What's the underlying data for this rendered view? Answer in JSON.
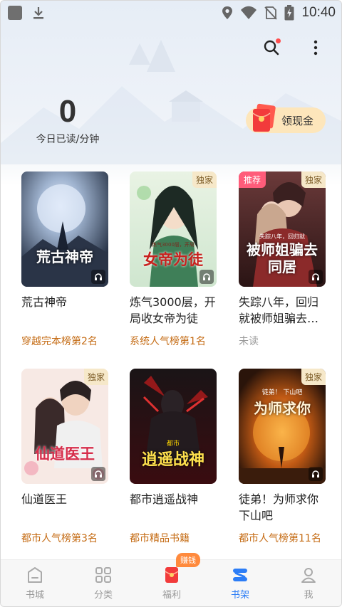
{
  "status_bar": {
    "time": "10:40",
    "icons": [
      "app-square-icon",
      "download-icon",
      "location-icon",
      "wifi-icon",
      "no-sim-icon",
      "battery-charging-icon"
    ]
  },
  "header": {
    "search_icon": "search-icon",
    "more_icon": "more-vertical-icon"
  },
  "reading": {
    "value": "0",
    "label": "今日已读/分钟"
  },
  "withdraw": {
    "label": "领现金"
  },
  "books": [
    {
      "title": "荒古神帝",
      "tag": "穿越完本榜第2名",
      "exclusive": "",
      "recommend": "",
      "cover_title": "荒古神帝",
      "cover_sub": ""
    },
    {
      "title": "炼气3000层，开局收女帝为徒",
      "tag": "系统人气榜第1名",
      "exclusive": "独家",
      "recommend": "",
      "cover_title": "女帝为徒",
      "cover_sub": "炼气3000层，开局"
    },
    {
      "title": "失踪八年，回归就被师姐骗去…",
      "tag": "未读",
      "exclusive": "独家",
      "recommend": "推荐",
      "cover_title": "被师姐骗去同居",
      "cover_sub": "失踪八年，回归就"
    },
    {
      "title": "仙道医王",
      "tag": "都市人气榜第3名",
      "exclusive": "独家",
      "recommend": "",
      "cover_title": "仙道医王",
      "cover_sub": ""
    },
    {
      "title": "都市逍遥战神",
      "tag": "都市精品书籍",
      "exclusive": "",
      "recommend": "",
      "cover_title": "逍遥战神",
      "cover_sub": "都市"
    },
    {
      "title": "徒弟！为师求你下山吧",
      "tag": "都市人气榜第11名",
      "exclusive": "独家",
      "recommend": "",
      "cover_title": "为师求你",
      "cover_sub": "徒弟！ 下山吧"
    }
  ],
  "bottom_nav": [
    {
      "label": "书城",
      "icon": "store-icon",
      "active": false
    },
    {
      "label": "分类",
      "icon": "category-grid-icon",
      "active": false
    },
    {
      "label": "福利",
      "icon": "red-envelope-icon",
      "active": false,
      "badge": "赚钱"
    },
    {
      "label": "书架",
      "icon": "bookshelf-icon",
      "active": true
    },
    {
      "label": "我",
      "icon": "profile-icon",
      "active": false
    }
  ],
  "colors": {
    "accent_blue": "#2c7df6",
    "tag_orange": "#c46a12",
    "tag_highlight": "#fde3c0",
    "withdraw_bg": "#fde6bb",
    "exclusive_bg": "#f6e8c9",
    "recommend_bg": "#ff5c7a"
  }
}
